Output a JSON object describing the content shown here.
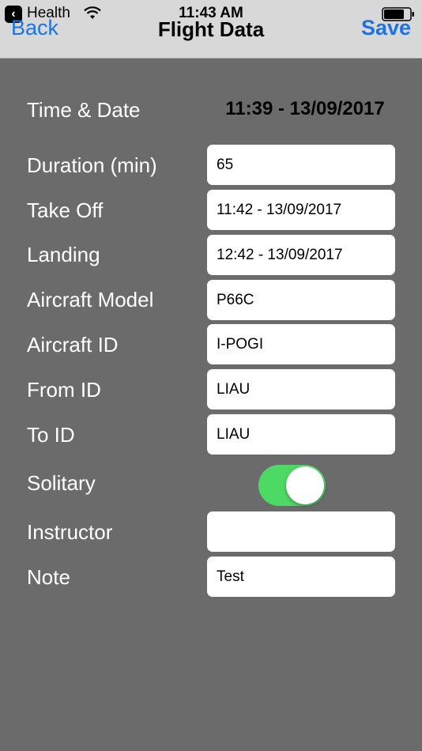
{
  "status_bar": {
    "back_app": "Health",
    "time": "11:43 AM"
  },
  "nav": {
    "back_label": "Back",
    "title": "Flight Data",
    "save_label": "Save"
  },
  "form": {
    "time_date_label": "Time & Date",
    "time_date_value": "11:39 - 13/09/2017",
    "duration_label": "Duration (min)",
    "duration_value": "65",
    "takeoff_label": "Take Off",
    "takeoff_value": "11:42 - 13/09/2017",
    "landing_label": "Landing",
    "landing_value": "12:42 - 13/09/2017",
    "aircraft_model_label": "Aircraft Model",
    "aircraft_model_value": "P66C",
    "aircraft_id_label": "Aircraft ID",
    "aircraft_id_value": "I-POGI",
    "from_id_label": "From ID",
    "from_id_value": "LIAU",
    "to_id_label": "To ID",
    "to_id_value": "LIAU",
    "solitary_label": "Solitary",
    "solitary_on": true,
    "instructor_label": "Instructor",
    "instructor_value": "",
    "note_label": "Note",
    "note_value": "Test"
  },
  "colors": {
    "accent": "#1a73e8",
    "background": "#6b6b6b",
    "toggle_on": "#4cd964"
  }
}
